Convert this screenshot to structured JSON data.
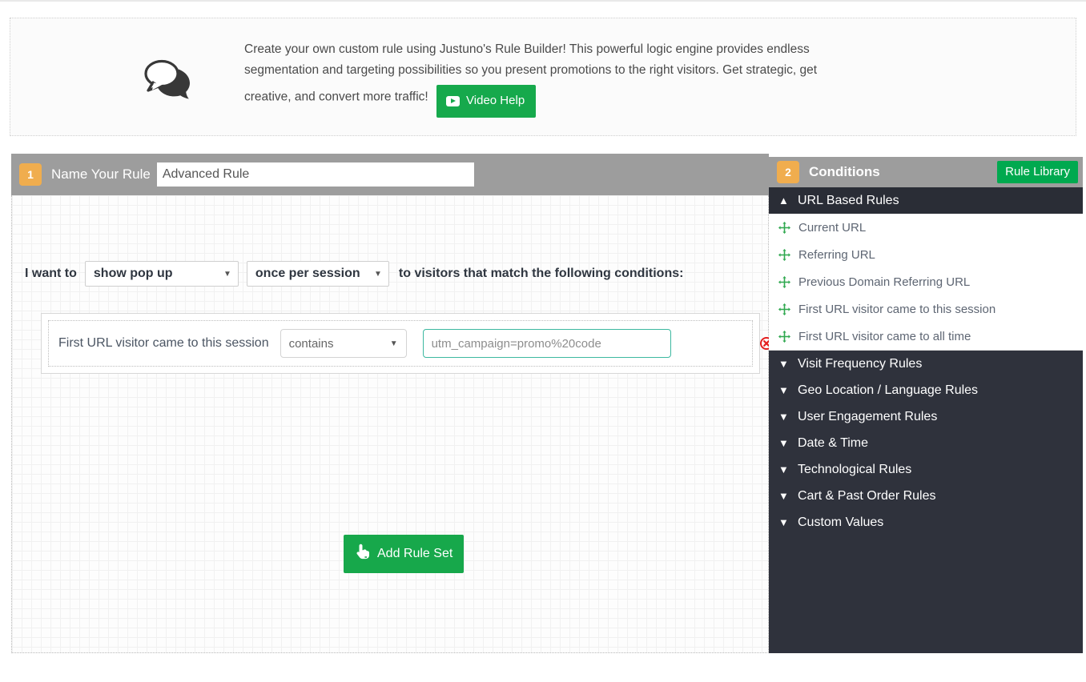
{
  "info": {
    "icon": "speech-bubbles-icon",
    "line1": "Create your own custom rule using Justuno's Rule Builder!   This powerful logic engine provides endless",
    "line2": "segmentation and targeting possibilities so you present promotions to the right visitors. Get strategic, get",
    "line3": "creative, and convert more traffic!",
    "video_help_label": "Video Help"
  },
  "builder": {
    "step_number": "1",
    "header_label": "Name Your Rule",
    "rule_name_value": "Advanced Rule",
    "rule_name_placeholder": "Name Your Rule",
    "intent_prefix": "I want to",
    "action_select": "show pop up",
    "frequency_select": "once per session",
    "intent_suffix": "to visitors that match the following conditions:",
    "caret": "▼",
    "add_rule_set_label": "Add Rule Set",
    "rule_rows": [
      {
        "label": "First URL visitor came to this session",
        "operator": "contains",
        "value": "utm_campaign=promo%20code",
        "value_placeholder": "utm_campaign=promo%20code",
        "delete_icon": "delete-circle-icon"
      }
    ]
  },
  "conditions": {
    "step_number": "2",
    "title": "Conditions",
    "rule_library_label": "Rule Library",
    "categories": [
      {
        "label": "URL Based Rules",
        "expanded": true,
        "chevron": "▲",
        "items": [
          "Current URL",
          "Referring URL",
          "Previous Domain Referring URL",
          "First URL visitor came to this session",
          "First URL visitor came to all time"
        ]
      },
      {
        "label": "Visit Frequency Rules",
        "expanded": false,
        "chevron": "▼",
        "items": []
      },
      {
        "label": "Geo Location / Language Rules",
        "expanded": false,
        "chevron": "▼",
        "items": []
      },
      {
        "label": "User Engagement Rules",
        "expanded": false,
        "chevron": "▼",
        "items": []
      },
      {
        "label": "Date & Time",
        "expanded": false,
        "chevron": "▼",
        "items": []
      },
      {
        "label": "Technological Rules",
        "expanded": false,
        "chevron": "▼",
        "items": []
      },
      {
        "label": "Cart & Past Order Rules",
        "expanded": false,
        "chevron": "▼",
        "items": []
      },
      {
        "label": "Custom Values",
        "expanded": false,
        "chevron": "▼",
        "items": []
      }
    ]
  },
  "colors": {
    "brand_green": "#17a84b",
    "library_green": "#00a94f",
    "step_orange": "#f0ad4e",
    "header_gray": "#9d9d9d",
    "sidebar_dark": "#2f323c",
    "input_focus_teal": "#3cb8a0",
    "delete_red": "#e41f1f"
  }
}
